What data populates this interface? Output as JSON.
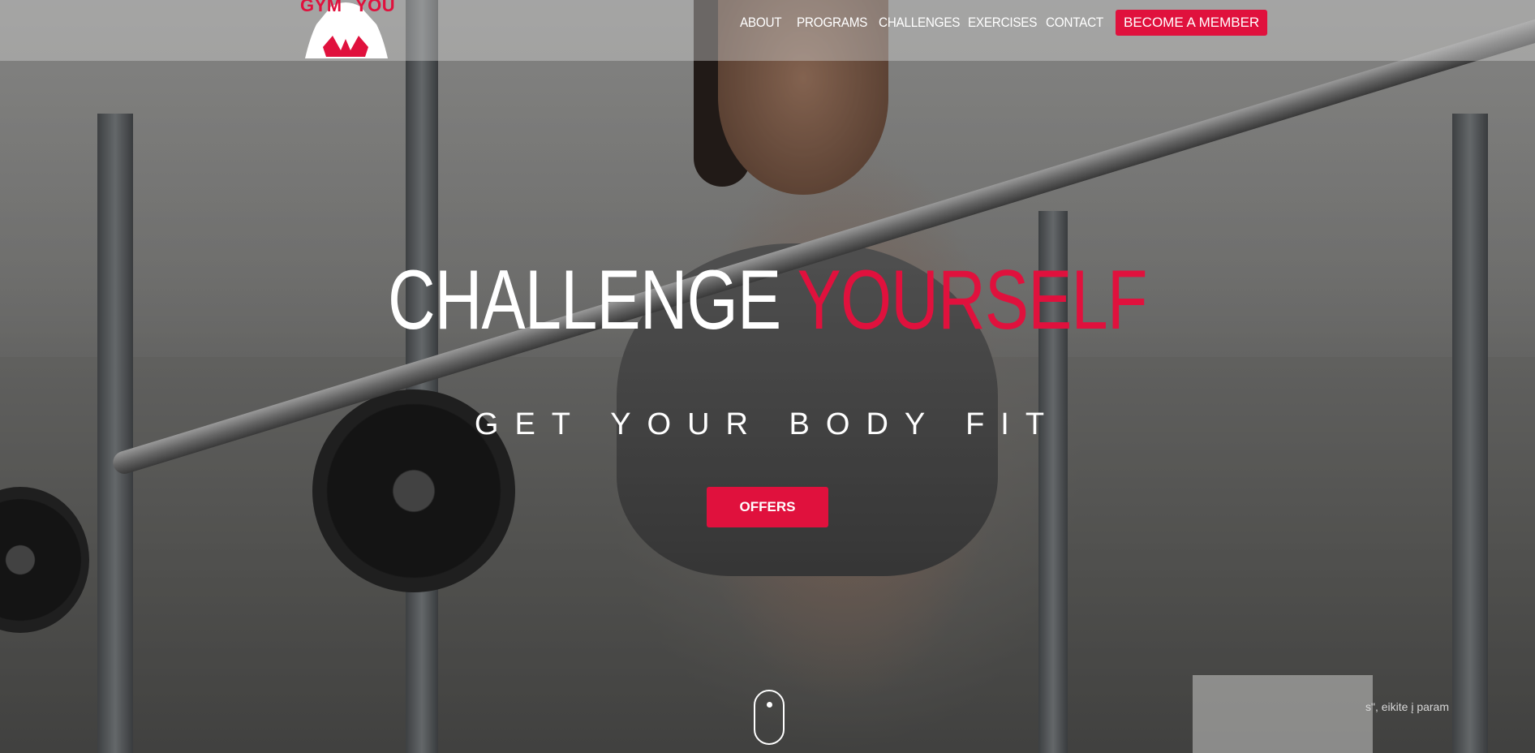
{
  "header": {
    "logo": {
      "left_text": "GYM",
      "right_text": "YOU"
    },
    "nav": [
      {
        "label": "ABOUT"
      },
      {
        "label": "PROGRAMS"
      },
      {
        "label": "CHALLENGES"
      },
      {
        "label": "EXERCISES"
      },
      {
        "label": "CONTACT"
      }
    ],
    "cta_label": "BECOME A MEMBER"
  },
  "hero": {
    "title_part1": "CHALLENGE",
    "title_part2": "YOURSELF",
    "subtitle": "GET YOUR BODY FIT",
    "offers_button": "OFFERS"
  },
  "popup": {
    "text_fragment": "s\", eikite į param"
  },
  "colors": {
    "accent": "#e0113d",
    "text_light": "#ffffff"
  },
  "icons": {
    "scroll": "mouse-scroll-icon",
    "logo": "gym-logo-icon"
  }
}
